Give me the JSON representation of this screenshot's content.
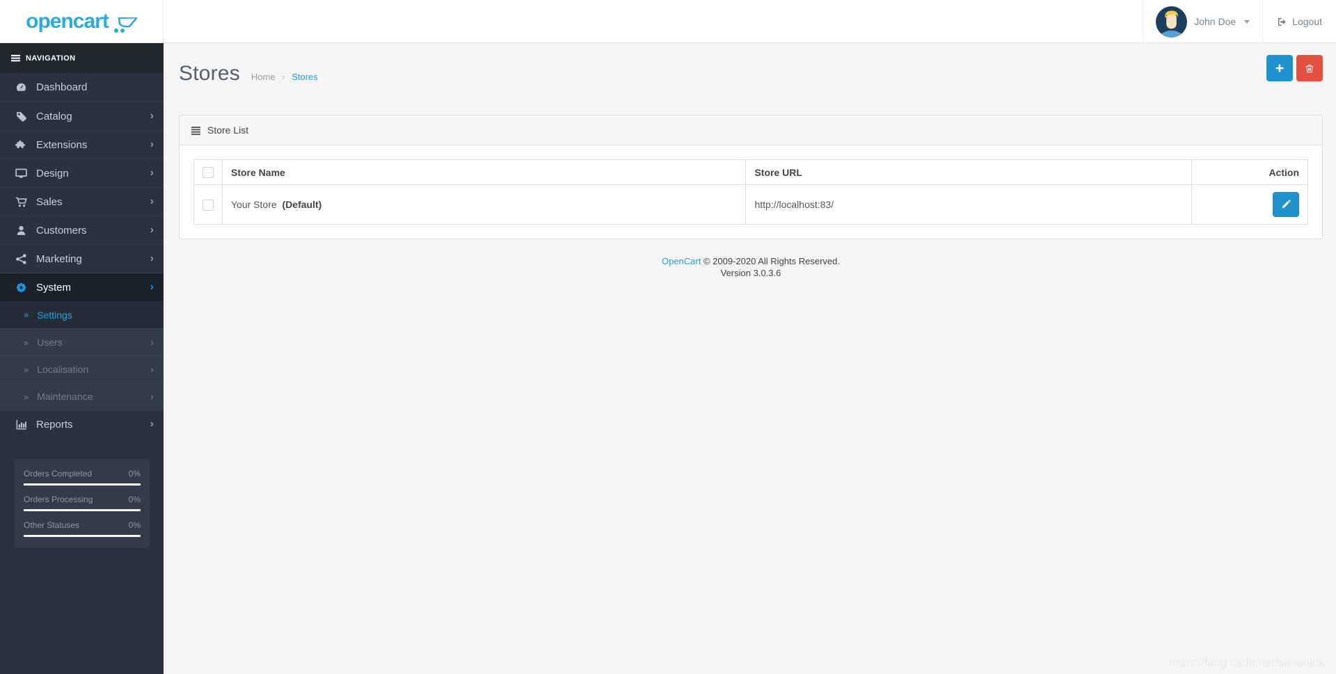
{
  "topbar": {
    "logo_text": "opencart",
    "user_name": "John Doe",
    "logout_label": "Logout"
  },
  "sidebar": {
    "nav_header": "NAVIGATION",
    "items": [
      {
        "label": "Dashboard"
      },
      {
        "label": "Catalog"
      },
      {
        "label": "Extensions"
      },
      {
        "label": "Design"
      },
      {
        "label": "Sales"
      },
      {
        "label": "Customers"
      },
      {
        "label": "Marketing"
      },
      {
        "label": "System"
      },
      {
        "label": "Reports"
      }
    ],
    "system_submenu": [
      {
        "label": "Settings"
      },
      {
        "label": "Users"
      },
      {
        "label": "Localisation"
      },
      {
        "label": "Maintenance"
      }
    ],
    "stats": [
      {
        "label": "Orders Completed",
        "value": "0%"
      },
      {
        "label": "Orders Processing",
        "value": "0%"
      },
      {
        "label": "Other Statuses",
        "value": "0%"
      }
    ]
  },
  "page": {
    "title": "Stores",
    "breadcrumb_home": "Home",
    "breadcrumb_separator": "›",
    "breadcrumb_current": "Stores"
  },
  "panel": {
    "title": "Store List",
    "columns": {
      "name": "Store Name",
      "url": "Store URL",
      "action": "Action"
    },
    "rows": [
      {
        "name": "Your Store",
        "name_bold": "(Default)",
        "url": "http://localhost:83/"
      }
    ]
  },
  "footer": {
    "link_label": "OpenCart",
    "copyright": "© 2009-2020 All Rights Reserved.",
    "version": "Version 3.0.3.6"
  },
  "watermark": "https://blog.csdn.net/simonluk",
  "icons": {
    "chevron_right": "›",
    "double_angle": "»"
  },
  "colors": {
    "accent_blue": "#2093ce",
    "link_blue": "#23a1d1",
    "danger_red": "#e2503f",
    "sidebar_bg": "#29323e",
    "sidebar_header_bg": "#20272f",
    "sidebar_active_bg": "#1a212b",
    "submenu_bg": "#323b49",
    "content_bg": "#f5f5f5"
  }
}
